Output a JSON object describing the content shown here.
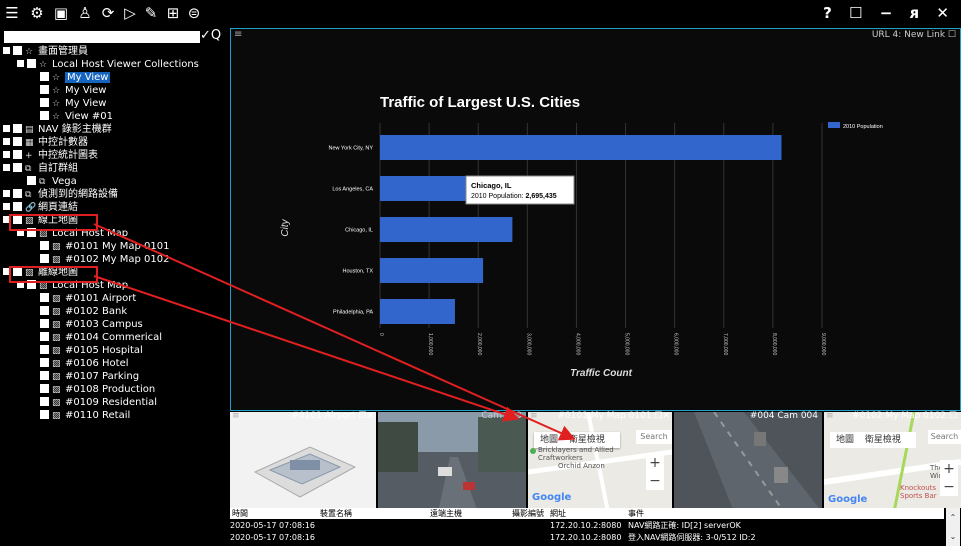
{
  "window": {
    "controls": "? ☐ − ᴙ ✕",
    "help_label": "?",
    "max_label": "☐",
    "min_label": "−",
    "restore_label": "ᴙ",
    "close_label": "✕"
  },
  "toolbar": {
    "icons": [
      "menu-icon",
      "settings-icon",
      "screen-icon",
      "user-map-icon",
      "refresh-icon",
      "play-icon",
      "map-edit-icon",
      "grid-icon",
      "database-icon"
    ]
  },
  "tree": {
    "search": {
      "value": "",
      "placeholder": ""
    },
    "nodes": [
      {
        "label": "畫面管理員"
      },
      {
        "label": "Local Host Viewer Collections"
      },
      {
        "label": "My View"
      },
      {
        "label": "My View"
      },
      {
        "label": "My View"
      },
      {
        "label": "View #01"
      },
      {
        "label": "NAV 錄影主機群"
      },
      {
        "label": "中控計數器"
      },
      {
        "label": "中控統計圖表"
      },
      {
        "label": "自訂群組"
      },
      {
        "label": "Vega"
      },
      {
        "label": "偵測到的網路設備"
      },
      {
        "label": "網頁連結"
      },
      {
        "label": "線上地圖"
      },
      {
        "label": "Local Host Map"
      },
      {
        "label": "#0101 My Map 0101"
      },
      {
        "label": "#0102 My Map 0102"
      },
      {
        "label": "離線地圖"
      },
      {
        "label": "Local Host Map"
      },
      {
        "label": "#0101 Airport"
      },
      {
        "label": "#0102 Bank"
      },
      {
        "label": "#0103 Campus"
      },
      {
        "label": "#0104 Commerical"
      },
      {
        "label": "#0105 Hospital"
      },
      {
        "label": "#0106 Hotel"
      },
      {
        "label": "#0107 Parking"
      },
      {
        "label": "#0108 Production"
      },
      {
        "label": "#0109 Residential"
      },
      {
        "label": "#0110 Retail"
      }
    ]
  },
  "chart_pane": {
    "header": "URL 4: New Link ☐"
  },
  "chart_data": {
    "type": "bar",
    "title": "Traffic of Largest U.S. Cities",
    "xlabel": "Traffic Count",
    "ylabel": "City",
    "categories": [
      "New York City, NY",
      "Los Angeles, CA",
      "Chicago, IL",
      "Houston, TX",
      "Philadelphia, PA"
    ],
    "series": [
      {
        "name": "2010 Population",
        "values": [
          8175000,
          3792000,
          2695435,
          2099000,
          1526000
        ],
        "color": "#3366cc"
      }
    ],
    "xlim": [
      0,
      9000000
    ],
    "x_ticks": [
      "0",
      "1,000,000",
      "2,000,000",
      "3,000,000",
      "4,000,000",
      "5,000,000",
      "6,000,000",
      "7,000,000",
      "8,000,000",
      "9,000,000"
    ],
    "legend_position": "top-right",
    "tooltip": {
      "title": "Chicago, IL",
      "label": "2010 Population: ",
      "value": "2,695,435"
    }
  },
  "cameras": [
    {
      "title": "#0101 Airport ☐✕"
    },
    {
      "title": "Cam 003"
    },
    {
      "title": "#0101 My Map 0101 ☐✕"
    },
    {
      "title": "#004 Cam 004"
    },
    {
      "title": "#0102 My Map 0102 ☐"
    }
  ],
  "map_widget": {
    "tab_map": "地圖",
    "tab_satellite": "衛星檢視",
    "search": "Search"
  },
  "map_labels": {
    "place1": "Bricklayers and Allied Craftworkers",
    "place2": "Orchid Anzon",
    "place3": "Knockouts Sports Bar",
    "place4": "The Wind",
    "google": "Google"
  },
  "log": {
    "headers": [
      "時間",
      "裝置名稱",
      "遠端主機",
      "攝影編號",
      "網址",
      "事件"
    ],
    "rows": [
      [
        "2020-05-17 07:08:16",
        "",
        "",
        "",
        "172.20.10.2:8080",
        "NAV網路正確: ID[2] serverOK"
      ],
      [
        "2020-05-17 07:08:16",
        "",
        "",
        "",
        "172.20.10.2:8080",
        "登入NAV網路伺服器: 3-0/512 ID:2"
      ]
    ]
  },
  "colors": {
    "accent_border": "#1ea0c8",
    "bar": "#3366cc",
    "annotation": "#e02020",
    "selection": "#1565c0"
  }
}
